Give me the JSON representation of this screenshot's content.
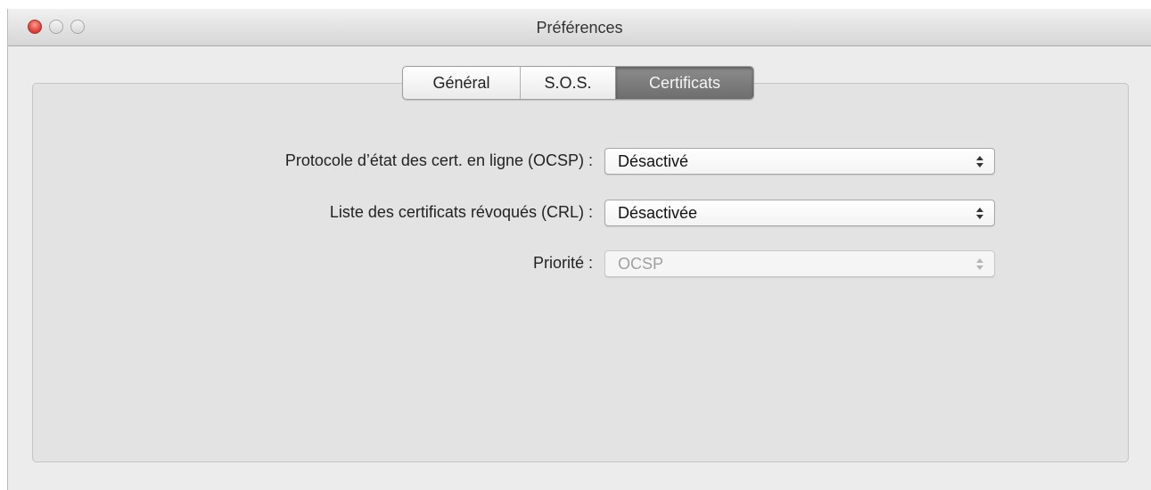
{
  "window": {
    "title": "Préférences"
  },
  "tabs": [
    {
      "label": "Général",
      "selected": false
    },
    {
      "label": "S.O.S.",
      "selected": false
    },
    {
      "label": "Certificats",
      "selected": true
    }
  ],
  "settings": {
    "ocsp": {
      "label": "Protocole d’état des cert. en ligne (OCSP) :",
      "value": "Désactivé",
      "enabled": true
    },
    "crl": {
      "label": "Liste des certificats révoqués (CRL) :",
      "value": "Désactivée",
      "enabled": true
    },
    "priority": {
      "label": "Priorité :",
      "value": "OCSP",
      "enabled": false
    }
  },
  "colors": {
    "close_button": "#e0443a",
    "selected_tab": "#7d7d7d",
    "panel_background": "#e3e3e3"
  },
  "icons": [
    "close-icon",
    "minimize-icon",
    "zoom-icon",
    "popup-arrows-icon"
  ]
}
